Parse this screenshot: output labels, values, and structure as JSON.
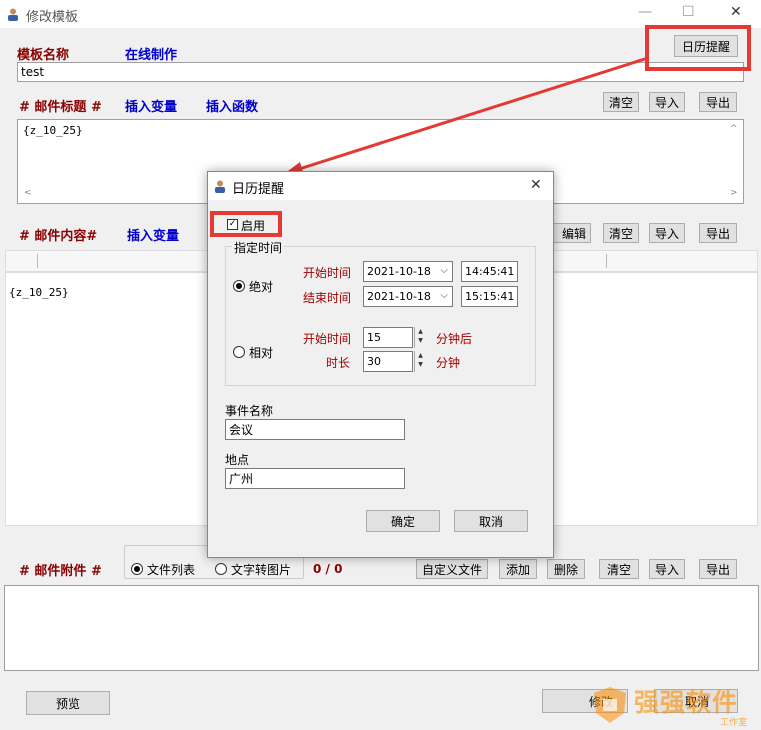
{
  "window": {
    "title": "修改模板",
    "controls": {
      "minimize": "—",
      "maximize": "☐",
      "close": "✕"
    }
  },
  "template_name": {
    "label": "模板名称",
    "online_label": "在线制作",
    "value": "test",
    "calendar_button": "日历提醒"
  },
  "email_subject": {
    "label": "# 邮件标题 #",
    "insert_var": "插入变量",
    "insert_func": "插入函数",
    "clear": "清空",
    "import": "导入",
    "export": "导出",
    "content": "{z_10_25}"
  },
  "email_body": {
    "label": "# 邮件内容#",
    "insert_var": "插入变量",
    "edit": "编辑",
    "clear": "清空",
    "import": "导入",
    "export": "导出",
    "content": "{z_10_25}"
  },
  "attachments": {
    "label": "# 邮件附件 #",
    "radio_file_list": "文件列表",
    "radio_text_to_image": "文字转图片",
    "count": "0 / 0",
    "custom_file": "自定义文件",
    "add": "添加",
    "delete": "删除",
    "clear": "清空",
    "import": "导入",
    "export": "导出"
  },
  "footer": {
    "preview": "预览",
    "confirm_partial": "修改",
    "cancel_partial": "取消"
  },
  "dialog": {
    "title": "日历提醒",
    "close": "✕",
    "enable_label": "启用",
    "enable_checked": true,
    "group_label": "指定时间",
    "absolute_label": "绝对",
    "relative_label": "相对",
    "mode": "absolute",
    "start_time_label": "开始时间",
    "end_time_label": "结束时间",
    "start_date": "2021-10-18",
    "start_time": "14:45:41",
    "end_date": "2021-10-18",
    "end_time": "15:15:41",
    "rel_start_label": "开始时间",
    "rel_start_value": "15",
    "rel_start_unit": "分钟后",
    "duration_label": "时长",
    "duration_value": "30",
    "duration_unit": "分钟",
    "event_name_label": "事件名称",
    "event_name_value": "会议",
    "location_label": "地点",
    "location_value": "广州",
    "ok": "确定",
    "cancel": "取消"
  },
  "watermark": {
    "main": "强强软件",
    "sub": "工作室"
  },
  "colors": {
    "highlight": "#e53935",
    "label_red": "#8b0000",
    "label_blue": "#0000cc"
  }
}
